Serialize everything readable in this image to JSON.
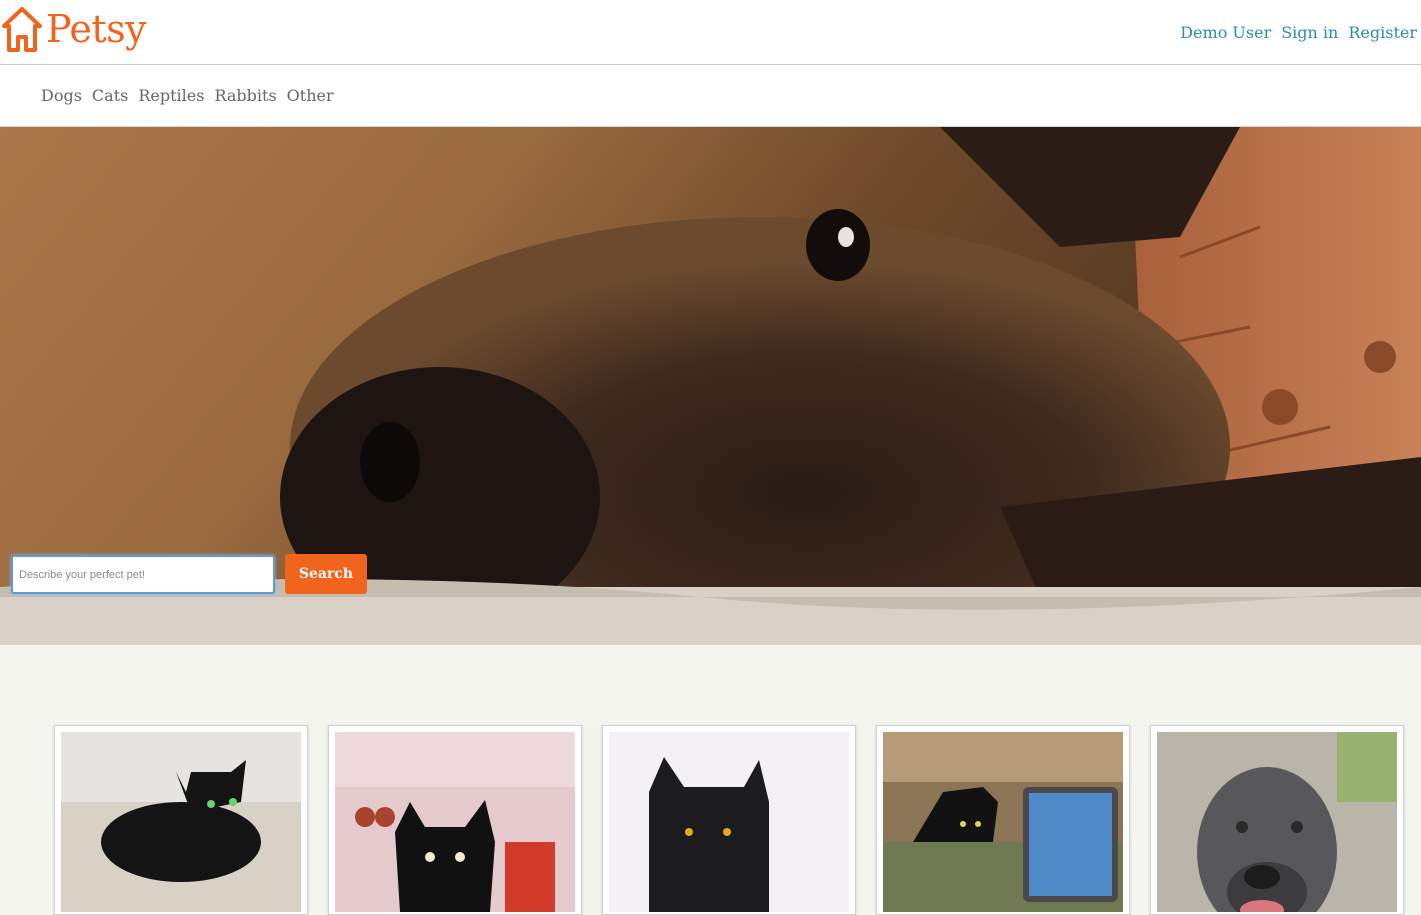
{
  "header": {
    "logo_text": "Petsy",
    "brand_color": "#f1641e",
    "user_links": [
      "Demo User",
      "Sign in",
      "Register"
    ]
  },
  "nav": {
    "categories": [
      "Dogs",
      "Cats",
      "Reptiles",
      "Rabbits",
      "Other"
    ]
  },
  "hero": {
    "image": "dog-face-photo",
    "search": {
      "placeholder": "Describe your perfect pet!",
      "button_label": "Search"
    }
  },
  "listings": [
    {
      "image": "black-cat-on-bed-photo"
    },
    {
      "image": "black-cat-pink-room-photo"
    },
    {
      "image": "black-cat-bright-photo"
    },
    {
      "image": "black-cat-with-tablet-photo"
    },
    {
      "image": "grey-pitbull-in-car-photo"
    }
  ]
}
